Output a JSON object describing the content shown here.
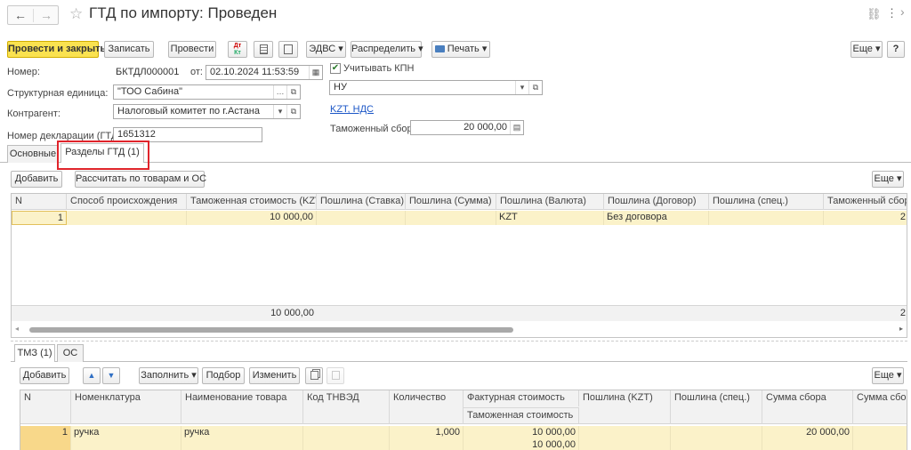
{
  "window": {
    "title": "ГТД по импорту: Проведен",
    "back_glyph": "←",
    "forward_glyph": "→",
    "star_glyph": "☆",
    "link_glyph": "🔗",
    "more_glyph": "⋮",
    "close_glyph": "×"
  },
  "toolbar": {
    "post_close": "Провести и закрыть",
    "save": "Записать",
    "post": "Провести",
    "dt_kt": "Дт Кт",
    "edvs": "ЭДВС",
    "distribute": "Распределить",
    "print": "Печать",
    "more": "Еще",
    "help": "?"
  },
  "form": {
    "number_label": "Номер:",
    "number_value": "БКТДЛ000001",
    "from_label": "от:",
    "date_value": "02.10.2024 11:53:59",
    "kpn_label": "Учитывать КПН",
    "kpn_checked": "✔",
    "unit_label": "Структурная единица:",
    "unit_value": "\"ТОО Сабина\"",
    "nu_value": "НУ",
    "contractor_label": "Контрагент:",
    "contractor_value": "Налоговый комитет по г.Астана",
    "vat_link": "KZT, НДС",
    "customs_fee_label": "Таможенный сбор:",
    "customs_fee_value": "20 000,00",
    "declaration_label": "Номер декларации (ГТД):",
    "declaration_value": "1651312"
  },
  "tabs": {
    "main": "Основные",
    "sections": "Разделы ГТД (1)"
  },
  "sections_toolbar": {
    "add": "Добавить",
    "calculate": "Рассчитать по товарам и ОС",
    "more": "Еще"
  },
  "sections_table": {
    "headers": [
      "N",
      "Способ происхождения",
      "Таможенная стоимость (KZT)",
      "Пошлина (Ставка)",
      "Пошлина (Сумма)",
      "Пошлина (Валюта)",
      "Пошлина (Договор)",
      "Пошлина (спец.)",
      "Таможенный сбор"
    ],
    "row": {
      "n": "1",
      "customs_value": "10 000,00",
      "currency": "KZT",
      "contract": "Без договора",
      "fee_partial": "2"
    },
    "footer": {
      "customs_value": "10 000,00",
      "fee_partial": "2"
    }
  },
  "subtabs": {
    "tmz": "ТМЗ (1)",
    "os": "ОС"
  },
  "goods_toolbar": {
    "add": "Добавить",
    "up": "▲",
    "down": "▼",
    "fill": "Заполнить",
    "pick": "Подбор",
    "change": "Изменить",
    "more": "Еще"
  },
  "goods_table": {
    "headers": [
      "N",
      "Номенклатура",
      "Наименование товара",
      "Код ТНВЭД",
      "Количество",
      "Фактурная стоимость",
      "Пошлина (KZT)",
      "Пошлина (спец.)",
      "Сумма сбора",
      "Сумма сбо"
    ],
    "subheader": "Таможенная стоимость",
    "row": {
      "n": "1",
      "nomenclature": "ручка",
      "name": "ручка",
      "quantity": "1,000",
      "invoice_value": "10 000,00",
      "fee_sum": "20 000,00",
      "customs_value": "10 000,00"
    }
  },
  "colors": {
    "accent_yellow": "#fae250",
    "row_highlight": "#fbf2c9",
    "link_blue": "#1c57c7",
    "highlight_red": "#e0242b"
  }
}
